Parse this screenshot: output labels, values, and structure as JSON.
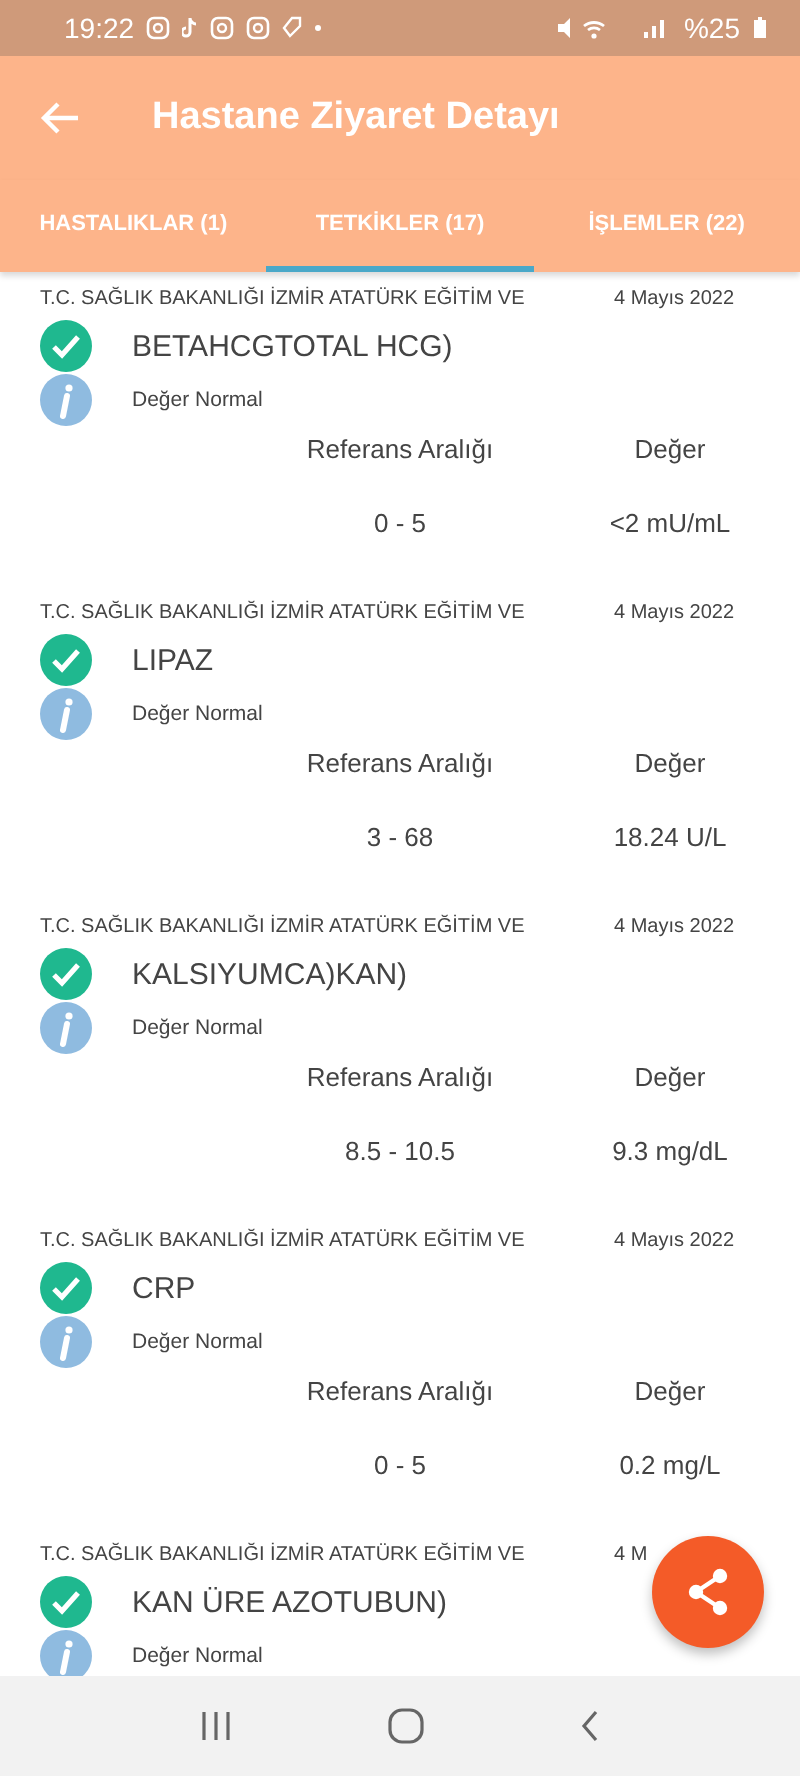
{
  "status_bar": {
    "time": "19:22",
    "battery": "%25"
  },
  "app_bar": {
    "title": "Hastane Ziyaret Detayı"
  },
  "tabs": [
    {
      "label": "HASTALIKLAR (1)",
      "selected": false
    },
    {
      "label": "TETKİKLER (17)",
      "selected": true
    },
    {
      "label": "İŞLEMLER (22)",
      "selected": false
    }
  ],
  "tests": [
    {
      "hospital": "T.C. SAĞLIK BAKANLIĞI İZMİR ATATÜRK EĞİTİM VE",
      "date": "4 Mayıs 2022",
      "name": "BETAHCGTOTAL HCG)",
      "checked": true,
      "note": "Değer Normal",
      "range_label": "Referans Aralığı",
      "value_label": "Değer",
      "range": "0 - 5",
      "value": "<2 mU/mL"
    },
    {
      "hospital": "T.C. SAĞLIK BAKANLIĞI İZMİR ATATÜRK EĞİTİM VE",
      "date": "4 Mayıs 2022",
      "name": "LIPAZ",
      "checked": true,
      "note": "Değer Normal",
      "range_label": "Referans Aralığı",
      "value_label": "Değer",
      "range": "3 - 68",
      "value": "18.24 U/L"
    },
    {
      "hospital": "T.C. SAĞLIK BAKANLIĞI İZMİR ATATÜRK EĞİTİM VE",
      "date": "4 Mayıs 2022",
      "name": "KALSIYUMCA)KAN)",
      "checked": true,
      "note": "Değer Normal",
      "range_label": "Referans Aralığı",
      "value_label": "Değer",
      "range": "8.5 - 10.5",
      "value": "9.3 mg/dL"
    },
    {
      "hospital": "T.C. SAĞLIK BAKANLIĞI İZMİR ATATÜRK EĞİTİM VE",
      "date": "4 Mayıs 2022",
      "name": "CRP",
      "checked": true,
      "note": "Değer Normal",
      "range_label": "Referans Aralığı",
      "value_label": "Değer",
      "range": "0 - 5",
      "value": "0.2 mg/L"
    },
    {
      "hospital": "T.C. SAĞLIK BAKANLIĞI İZMİR ATATÜRK EĞİTİM VE",
      "date": "4 M",
      "name": "KAN ÜRE AZOTUBUN)",
      "checked": true,
      "note": "Değer Normal"
    }
  ]
}
